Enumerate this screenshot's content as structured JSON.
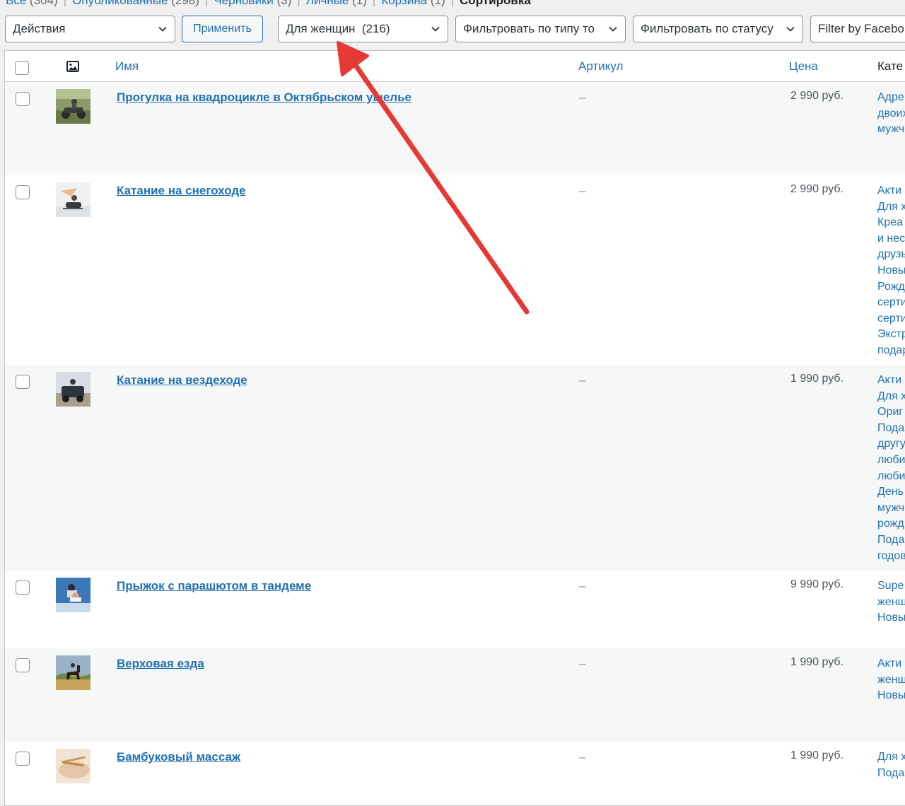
{
  "status_links": [
    {
      "label": "Все",
      "count": "(304)"
    },
    {
      "label": "Опубликованные",
      "count": "(298)"
    },
    {
      "label": "Черновики",
      "count": "(3)"
    },
    {
      "label": "Личные",
      "count": "(1)"
    },
    {
      "label": "Корзина",
      "count": "(1)"
    }
  ],
  "status_current": "Сортировка",
  "toolbar": {
    "bulk_actions": "Действия",
    "apply_label": "Применить",
    "category_filter": "Для женщин  (216)",
    "type_filter": "Фильтровать по типу то",
    "status_filter": "Фильтровать по статусу",
    "facebook_filter": "Filter by Facebo"
  },
  "columns": {
    "name": "Имя",
    "sku": "Артикул",
    "price": "Цена",
    "categories": "Кате"
  },
  "products": [
    {
      "name": "Прогулка на квадроцикле в Октябрьском ущелье",
      "sku": "–",
      "price": "2 990 руб.",
      "categories": [
        "Адре",
        "двоих",
        "мужч"
      ],
      "thumb": "quad-bike-photo"
    },
    {
      "name": "Катание на снегоходе",
      "sku": "–",
      "price": "2 990 руб.",
      "categories": [
        "Акти",
        "Для х",
        "Креа",
        "и нес",
        "друзь",
        "Новы",
        "Рожд",
        "серти",
        "серти",
        "Экстр",
        "подар"
      ],
      "thumb": "snowmobile-photo"
    },
    {
      "name": "Катание на вездеходе",
      "sku": "–",
      "price": "1 990 руб.",
      "categories": [
        "Акти",
        "Для х",
        "Ориг",
        "Пода",
        "другу",
        "люби",
        "люби",
        "День",
        "мужч",
        "рожд",
        "Пода",
        "годов"
      ],
      "thumb": "atv-offroad-photo"
    },
    {
      "name": "Прыжок с парашютом в тандеме",
      "sku": "–",
      "price": "9 990 руб.",
      "categories": [
        "Supe",
        "женщ",
        "Новы"
      ],
      "thumb": "parachute-photo"
    },
    {
      "name": "Верховая езда",
      "sku": "–",
      "price": "1 990 руб.",
      "categories": [
        "Акти",
        "женщ",
        "Новы"
      ],
      "thumb": "horse-riding-photo"
    },
    {
      "name": "Бамбуковый массаж",
      "sku": "–",
      "price": "1 990 руб.",
      "categories": [
        "Для х",
        "Пода"
      ],
      "thumb": "bamboo-massage-photo"
    }
  ],
  "colors": {
    "link": "#2271b1",
    "arrow": "#e53935"
  }
}
